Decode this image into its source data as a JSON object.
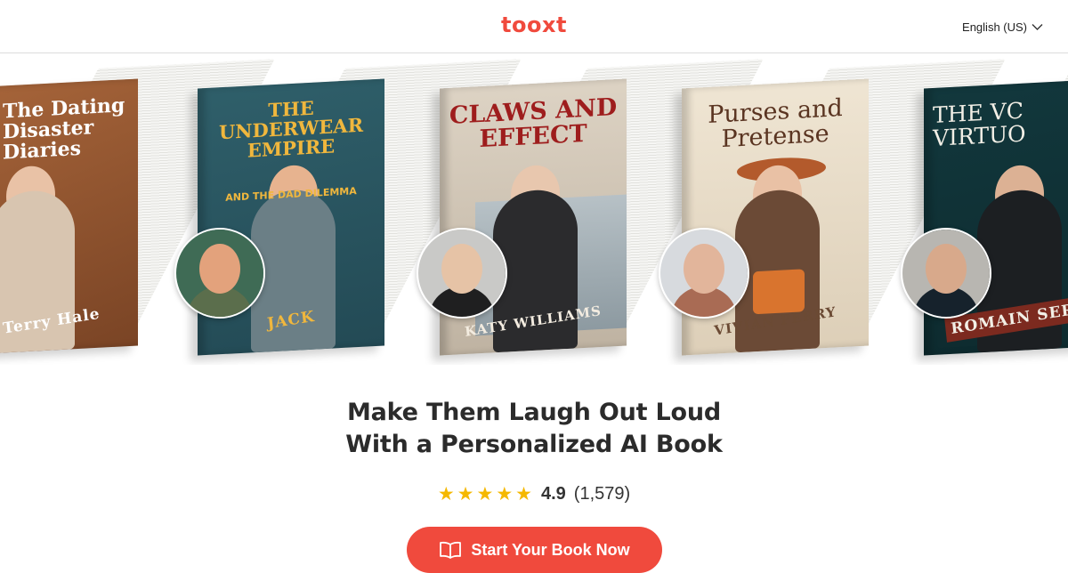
{
  "header": {
    "logo": "tooxt",
    "language": "English (US)"
  },
  "books": [
    {
      "title": "The Dating Disaster Diaries",
      "author": "Terry Hale"
    },
    {
      "title": "THE UNDERWEAR EMPIRE",
      "subtitle": "AND THE DAD DILEMMA",
      "author": "JACK"
    },
    {
      "title": "CLAWS AND EFFECT",
      "author": "KATY WILLIAMS"
    },
    {
      "title": "Purses and Pretense",
      "author": "VIVIAN PERRY"
    },
    {
      "title": "THE VC VIRTUO",
      "author": "ROMAIN SERM"
    }
  ],
  "hero": {
    "headline_line1": "Make Them Laugh Out Loud",
    "headline_line2": "With a Personalized AI Book"
  },
  "rating": {
    "stars": 5,
    "score": "4.9",
    "count": "(1,579)"
  },
  "cta": {
    "label": "Start Your Book Now"
  },
  "colors": {
    "brand": "#f04a3d",
    "star": "#f5b800"
  }
}
